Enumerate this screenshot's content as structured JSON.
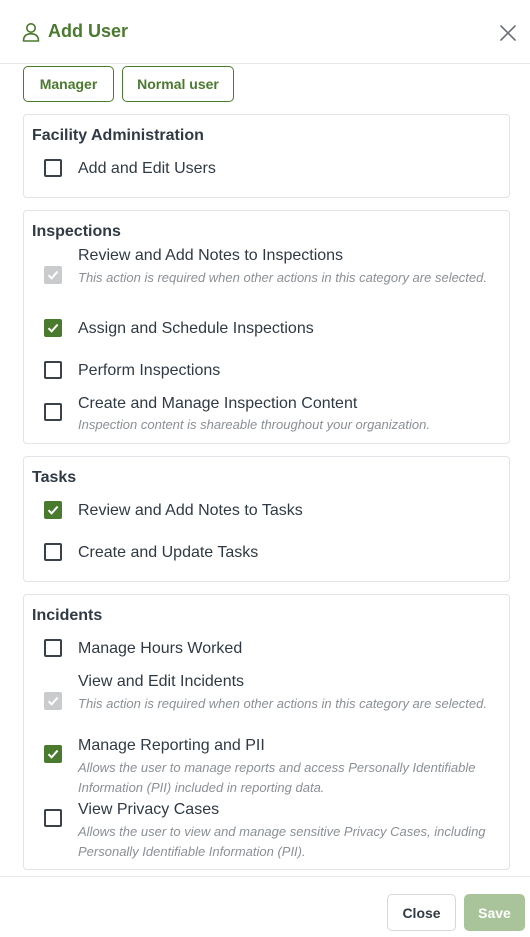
{
  "header": {
    "title": "Add User",
    "icon": "user-icon",
    "close_icon": "close-icon"
  },
  "roles": {
    "manager": "Manager",
    "normal_user": "Normal user"
  },
  "sections": {
    "facility": {
      "title": "Facility Administration",
      "items": [
        {
          "label": "Add and Edit Users",
          "state": "unchecked"
        }
      ]
    },
    "inspections": {
      "title": "Inspections",
      "items": [
        {
          "label": "Review and Add Notes to Inspections",
          "state": "disabled-checked",
          "desc": "This action is required when other actions in this category are selected."
        },
        {
          "label": "Assign and Schedule Inspections",
          "state": "checked"
        },
        {
          "label": "Perform Inspections",
          "state": "unchecked"
        },
        {
          "label": "Create and Manage Inspection Content",
          "state": "unchecked",
          "desc": "Inspection content is shareable throughout your organization."
        }
      ]
    },
    "tasks": {
      "title": "Tasks",
      "items": [
        {
          "label": "Review and Add Notes to Tasks",
          "state": "checked"
        },
        {
          "label": "Create and Update Tasks",
          "state": "unchecked"
        }
      ]
    },
    "incidents": {
      "title": "Incidents",
      "items": [
        {
          "label": "Manage Hours Worked",
          "state": "unchecked"
        },
        {
          "label": "View and Edit Incidents",
          "state": "disabled-checked",
          "desc": "This action is required when other actions in this category are selected."
        },
        {
          "label": "Manage Reporting and PII",
          "state": "checked",
          "desc": "Allows the user to manage reports and access Personally Identifiable Information (PII) included in reporting data."
        },
        {
          "label": "View Privacy Cases",
          "state": "unchecked",
          "desc": "Allows the user to view and manage sensitive Privacy Cases, including Personally Identifiable Information (PII)."
        }
      ]
    }
  },
  "footer": {
    "close_label": "Close",
    "save_label": "Save"
  },
  "colors": {
    "accent": "#4a7a2e",
    "save_disabled": "#a9c49a",
    "checkbox_disabled": "#c9cbcd"
  }
}
